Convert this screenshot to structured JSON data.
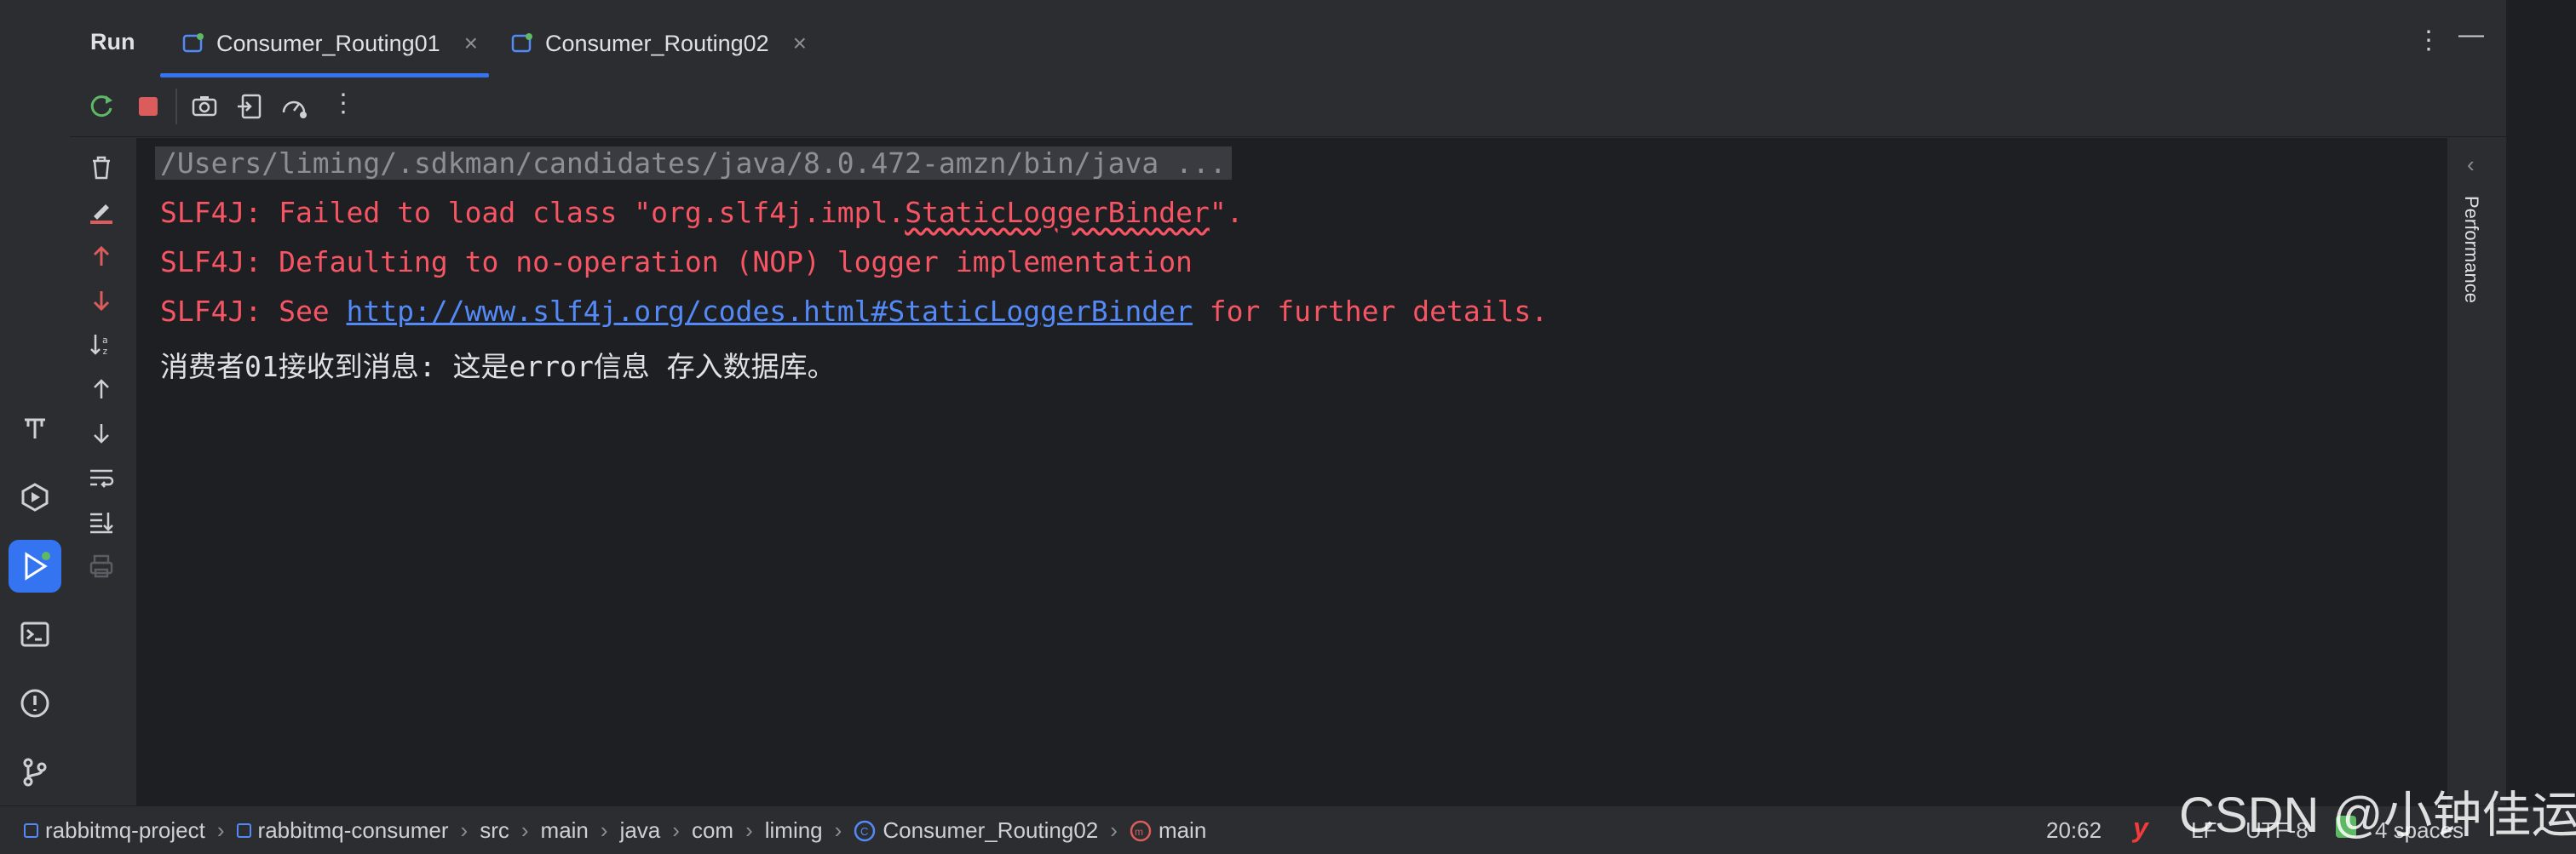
{
  "run_panel": {
    "title": "Run",
    "tabs": [
      {
        "label": "Consumer_Routing01",
        "active": true
      },
      {
        "label": "Consumer_Routing02",
        "active": false
      }
    ],
    "right_sidebar_label": "Performance"
  },
  "console": {
    "command_line": "/Users/liming/.sdkman/candidates/java/8.0.472-amzn/bin/java ...",
    "line1_prefix": "SLF4J: Failed to load class \"org.slf4j.impl.",
    "line1_class": "StaticLoggerBinder",
    "line1_suffix": "\".",
    "line2": "SLF4J: Defaulting to no-operation (NOP) logger implementation",
    "line3_prefix": "SLF4J: See ",
    "line3_link": "http://www.slf4j.org/codes.html#StaticLoggerBinder",
    "line3_suffix": " for further details.",
    "line4": "消费者01接收到消息: 这是error信息 存入数据库。"
  },
  "statusbar": {
    "breadcrumbs": [
      "rabbitmq-project",
      "rabbitmq-consumer",
      "src",
      "main",
      "java",
      "com",
      "liming",
      "Consumer_Routing02",
      "main"
    ],
    "position": "20:62",
    "line_ending": "LF",
    "encoding": "UTF-8",
    "indent": "4 spaces"
  },
  "watermark": "CSDN @小钟佳运",
  "colors": {
    "accent": "#3574f0",
    "error_text": "#f75464",
    "link": "#548af7",
    "console_bg": "#1e1f22",
    "panel_bg": "#2b2d30"
  }
}
